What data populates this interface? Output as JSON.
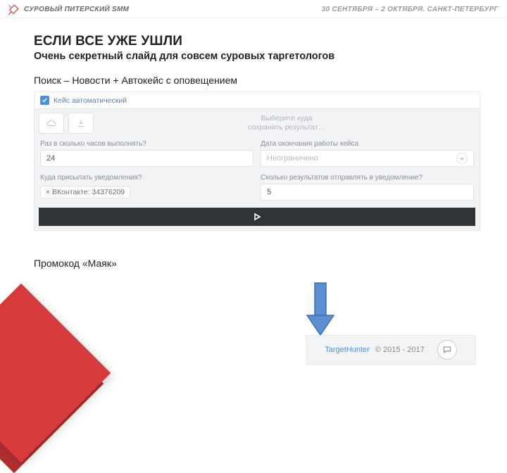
{
  "topbar": {
    "brand": "СУРОВЫЙ ПИТЕРСКИЙ SMM",
    "dateline": "30 СЕНТЯБРЯ – 2 ОКТЯБРЯ. САНКТ-ПЕТЕРБУРГ"
  },
  "heading": "ЕСЛИ ВСЕ УЖЕ УШЛИ",
  "subtitle": "Очень секретный слайд для совсем суровых таргетологов",
  "line1": "Поиск – Новости  + Автокейс с оповещением",
  "panel": {
    "checkbox_label": "Кейс автоматический",
    "save_hint_l1": "Выберите куда",
    "save_hint_l2": "сохранять результат…",
    "fields": {
      "interval_label": "Раз в сколько часов выполнять?",
      "interval_value": "24",
      "enddate_label": "Дата окончания работы кейса",
      "enddate_placeholder": "Неограничено",
      "notify_label": "Куда присылать уведомления?",
      "notify_chip": "× ВКонтакте: 34376209",
      "results_label": "Сколько результатов отправлять в уведомление?",
      "results_value": "5"
    }
  },
  "promo": "Промокод «Маяк»",
  "footer": {
    "product": "TargetHunter",
    "copyright": "© 2015 - 2017"
  }
}
